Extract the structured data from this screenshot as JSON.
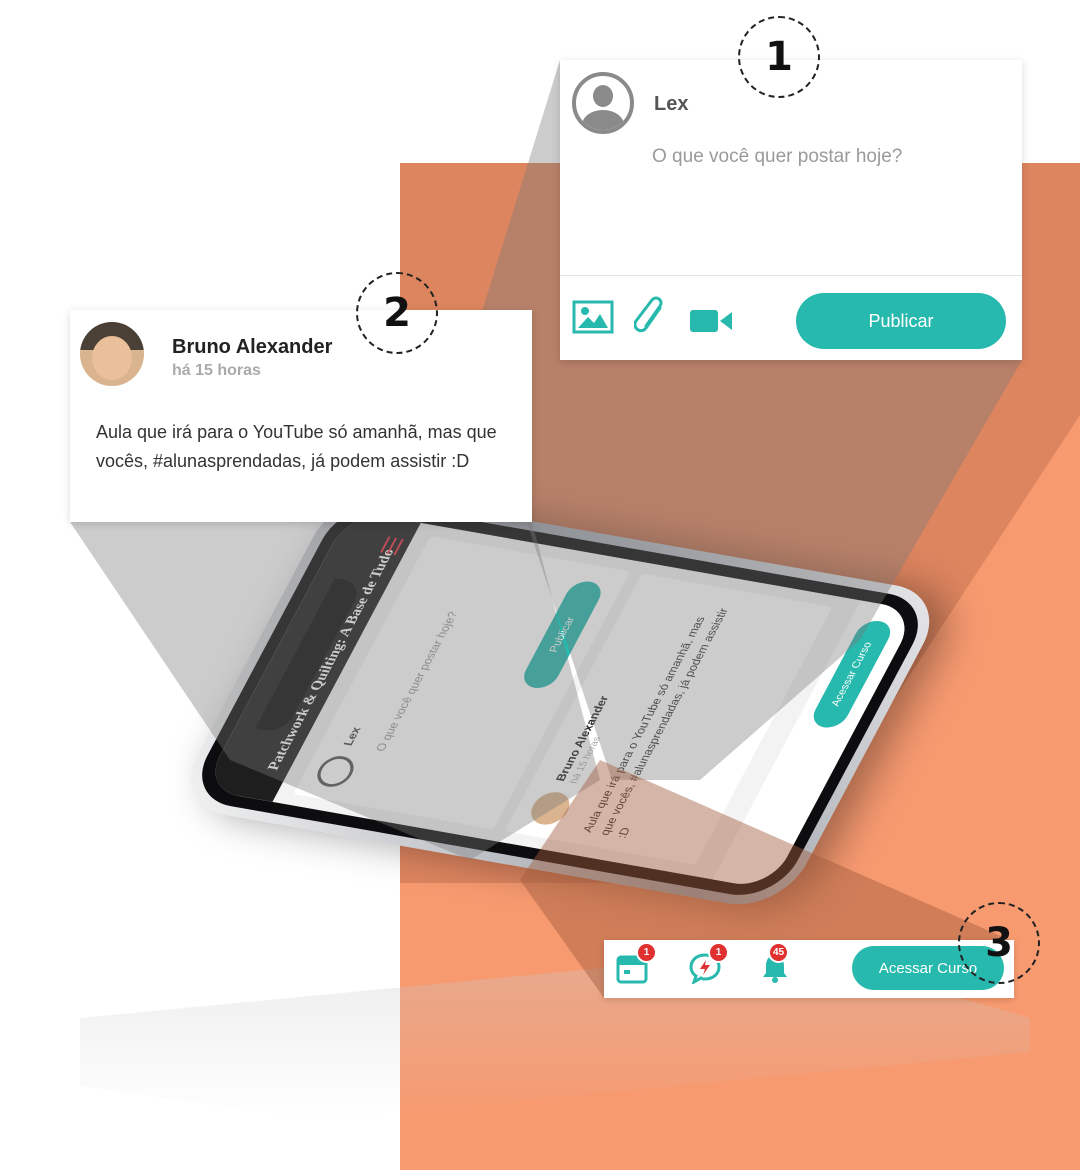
{
  "composer": {
    "user_name": "Lex",
    "placeholder": "O que você quer postar hoje?",
    "publish_label": "Publicar",
    "tools": [
      "image-icon",
      "paperclip-icon",
      "video-camera-icon"
    ]
  },
  "post": {
    "author": "Bruno Alexander",
    "time": "há 15 horas",
    "text": "Aula que irá para o YouTube só amanhã, mas que vocês, #alunasprendadas, já podem assistir :D"
  },
  "footer_bar": {
    "items": [
      {
        "icon": "calendar-icon",
        "badge": "1"
      },
      {
        "icon": "chat-bubble-icon",
        "badge": "1"
      },
      {
        "icon": "bell-icon",
        "badge": "45"
      }
    ],
    "access_label": "Acessar Curso"
  },
  "app": {
    "title": "Patchwork & Quilting: A Base de Tudo"
  },
  "markers": [
    "1",
    "2",
    "3"
  ],
  "colors": {
    "teal": "#27b9ad",
    "orange": "#f79a70",
    "badge_red": "#e03131"
  }
}
